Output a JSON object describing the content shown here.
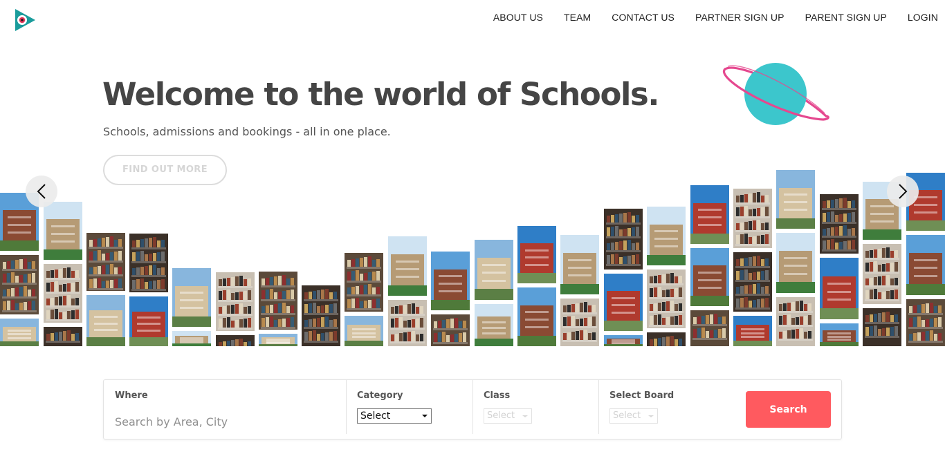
{
  "header": {
    "logo": "play-eye-logo",
    "nav": [
      {
        "label": "ABOUT US"
      },
      {
        "label": "TEAM"
      },
      {
        "label": "CONTACT US"
      },
      {
        "label": "PARTNER SIGN UP"
      },
      {
        "label": "PARENT SIGN UP"
      },
      {
        "label": "LOGIN"
      }
    ]
  },
  "hero": {
    "title": "Welcome to the world of Schools.",
    "subtitle": "Schools, admissions and bookings - all in one place.",
    "cta_label": "FIND OUT MORE",
    "planet_icon": "planet-icon"
  },
  "carousel": {
    "prev_icon": "chevron-left-icon",
    "next_icon": "chevron-right-icon"
  },
  "search": {
    "where": {
      "label": "Where",
      "placeholder": "Search by Area, City"
    },
    "category": {
      "label": "Category",
      "selected": "Select"
    },
    "class": {
      "label": "Class",
      "selected": "Select"
    },
    "board": {
      "label": "Select Board",
      "selected": "Select"
    },
    "button_label": "Search"
  },
  "colors": {
    "accent": "#ff5a5f",
    "logo_teal": "#1b9c9c",
    "planet_teal": "#3cc6cc",
    "ring_pink": "#e5488f",
    "heading": "#454545"
  }
}
